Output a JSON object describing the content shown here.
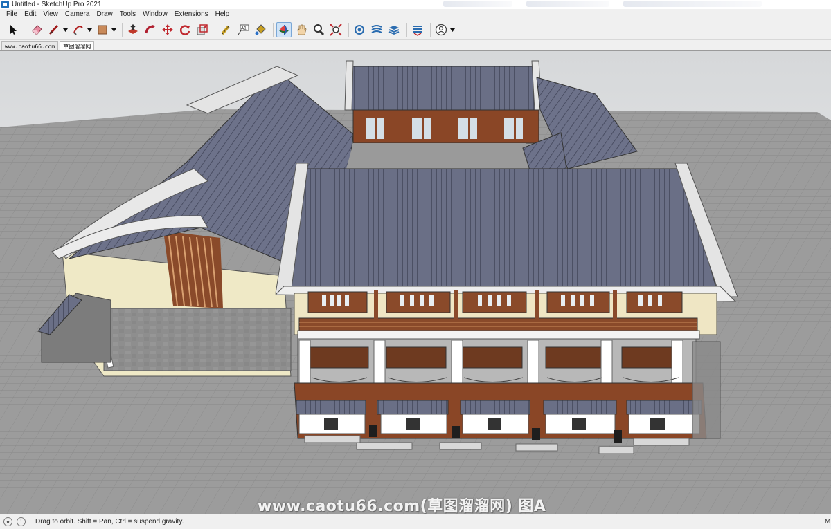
{
  "window": {
    "title": "Untitled - SketchUp Pro 2021"
  },
  "menu": [
    "File",
    "Edit",
    "View",
    "Camera",
    "Draw",
    "Tools",
    "Window",
    "Extensions",
    "Help"
  ],
  "toolbar": {
    "tools": [
      {
        "name": "select-tool-icon"
      },
      {
        "name": "eraser-tool-icon"
      },
      {
        "name": "line-tool-icon"
      },
      {
        "name": "arc-tool-icon"
      },
      {
        "name": "shape-tool-icon"
      },
      {
        "name": "push-pull-tool-icon"
      },
      {
        "name": "follow-me-tool-icon"
      },
      {
        "name": "move-tool-icon"
      },
      {
        "name": "rotate-tool-icon"
      },
      {
        "name": "scale-tool-icon"
      },
      {
        "name": "tape-measure-tool-icon"
      },
      {
        "name": "text-tool-icon"
      },
      {
        "name": "paint-bucket-tool-icon"
      },
      {
        "name": "orbit-tool-icon"
      },
      {
        "name": "pan-tool-icon"
      },
      {
        "name": "zoom-tool-icon"
      },
      {
        "name": "zoom-extents-tool-icon"
      },
      {
        "name": "3d-warehouse-icon"
      },
      {
        "name": "extension-warehouse-icon"
      },
      {
        "name": "layout-icon"
      },
      {
        "name": "extension-manager-icon"
      },
      {
        "name": "account-icon"
      }
    ],
    "text_tool_label": "A1"
  },
  "tabs": [
    {
      "label": "www.caotu66.com"
    },
    {
      "label": "草图溜溜网"
    }
  ],
  "viewport": {
    "watermark": "www.caotu66.com(草图溜溜网) 图A"
  },
  "status": {
    "text": "Drag to orbit. Shift = Pan, Ctrl = suspend gravity.",
    "right_label": "M"
  }
}
